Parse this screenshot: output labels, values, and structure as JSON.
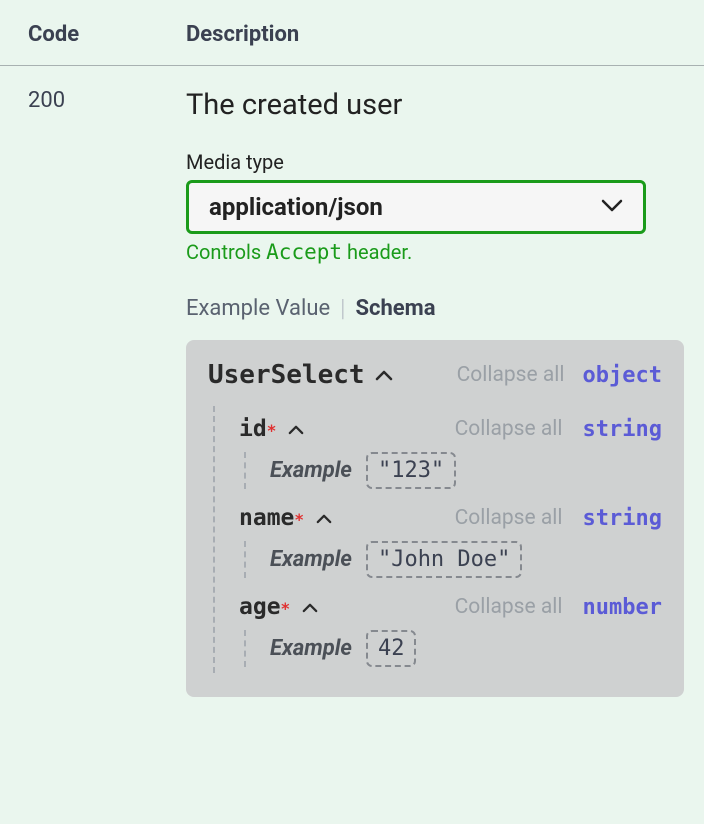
{
  "header": {
    "code_label": "Code",
    "description_label": "Description"
  },
  "response": {
    "code": "200",
    "description": "The created user",
    "media_type_label": "Media type",
    "media_type_value": "application/json",
    "accept_hint_prefix": "Controls ",
    "accept_hint_code": "Accept",
    "accept_hint_suffix": " header."
  },
  "tabs": {
    "example": "Example Value",
    "schema": "Schema"
  },
  "schema": {
    "name": "UserSelect",
    "collapse_all": "Collapse all",
    "type": "object",
    "fields": [
      {
        "name": "id",
        "type": "string",
        "collapse": "Collapse all",
        "example_label": "Example",
        "example_value": "\"123\""
      },
      {
        "name": "name",
        "type": "string",
        "collapse": "Collapse all",
        "example_label": "Example",
        "example_value": "\"John Doe\""
      },
      {
        "name": "age",
        "type": "number",
        "collapse": "Collapse all",
        "example_label": "Example",
        "example_value": "42"
      }
    ]
  }
}
